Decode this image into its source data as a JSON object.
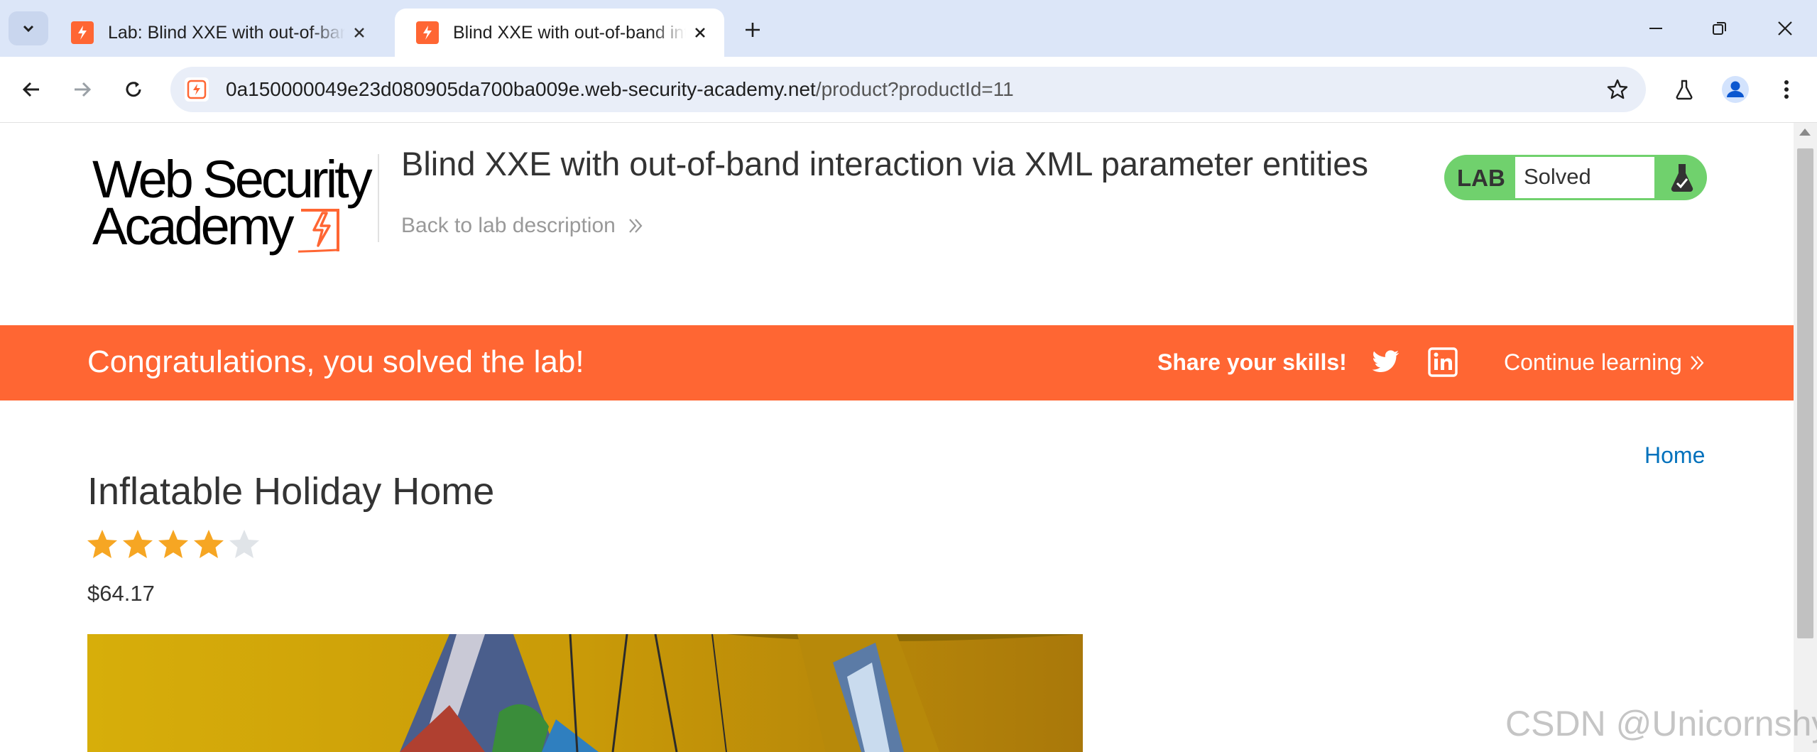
{
  "browser": {
    "tabs": [
      {
        "title": "Lab: Blind XXE with out-of-band interaction via XML parameter entities",
        "active": false
      },
      {
        "title": "Blind XXE with out-of-band interaction via XML parameter entities",
        "active": true
      }
    ],
    "url_host": "0a150000049e23d080905da700ba009e.web-security-academy.net",
    "url_path": "/product?productId=11",
    "icons": [
      "tab-search-icon",
      "close-icon",
      "new-tab-icon",
      "minimize-icon",
      "restore-icon",
      "window-close-icon",
      "back-icon",
      "forward-icon",
      "reload-icon",
      "site-info-icon",
      "bookmark-star-icon",
      "labs-flask-icon",
      "profile-icon",
      "menu-icon"
    ]
  },
  "header": {
    "logo_line1": "Web Security",
    "logo_line2": "Academy",
    "lab_title": "Blind XXE with out-of-band interaction via XML parameter entities",
    "back_link": "Back to lab description",
    "lab_label": "LAB",
    "lab_status": "Solved"
  },
  "banner": {
    "congrats": "Congratulations, you solved the lab!",
    "share": "Share your skills!",
    "continue": "Continue learning"
  },
  "nav": {
    "home": "Home"
  },
  "product": {
    "title": "Inflatable Holiday Home",
    "rating": 4,
    "rating_max": 5,
    "price": "$64.17"
  },
  "watermark": "CSDN @Unicornshy",
  "colors": {
    "accent": "#ff6633",
    "lab_green": "#70d16d",
    "link_blue": "#0071bc",
    "star_gold": "#f6a623",
    "star_empty": "#e0e4e8"
  }
}
